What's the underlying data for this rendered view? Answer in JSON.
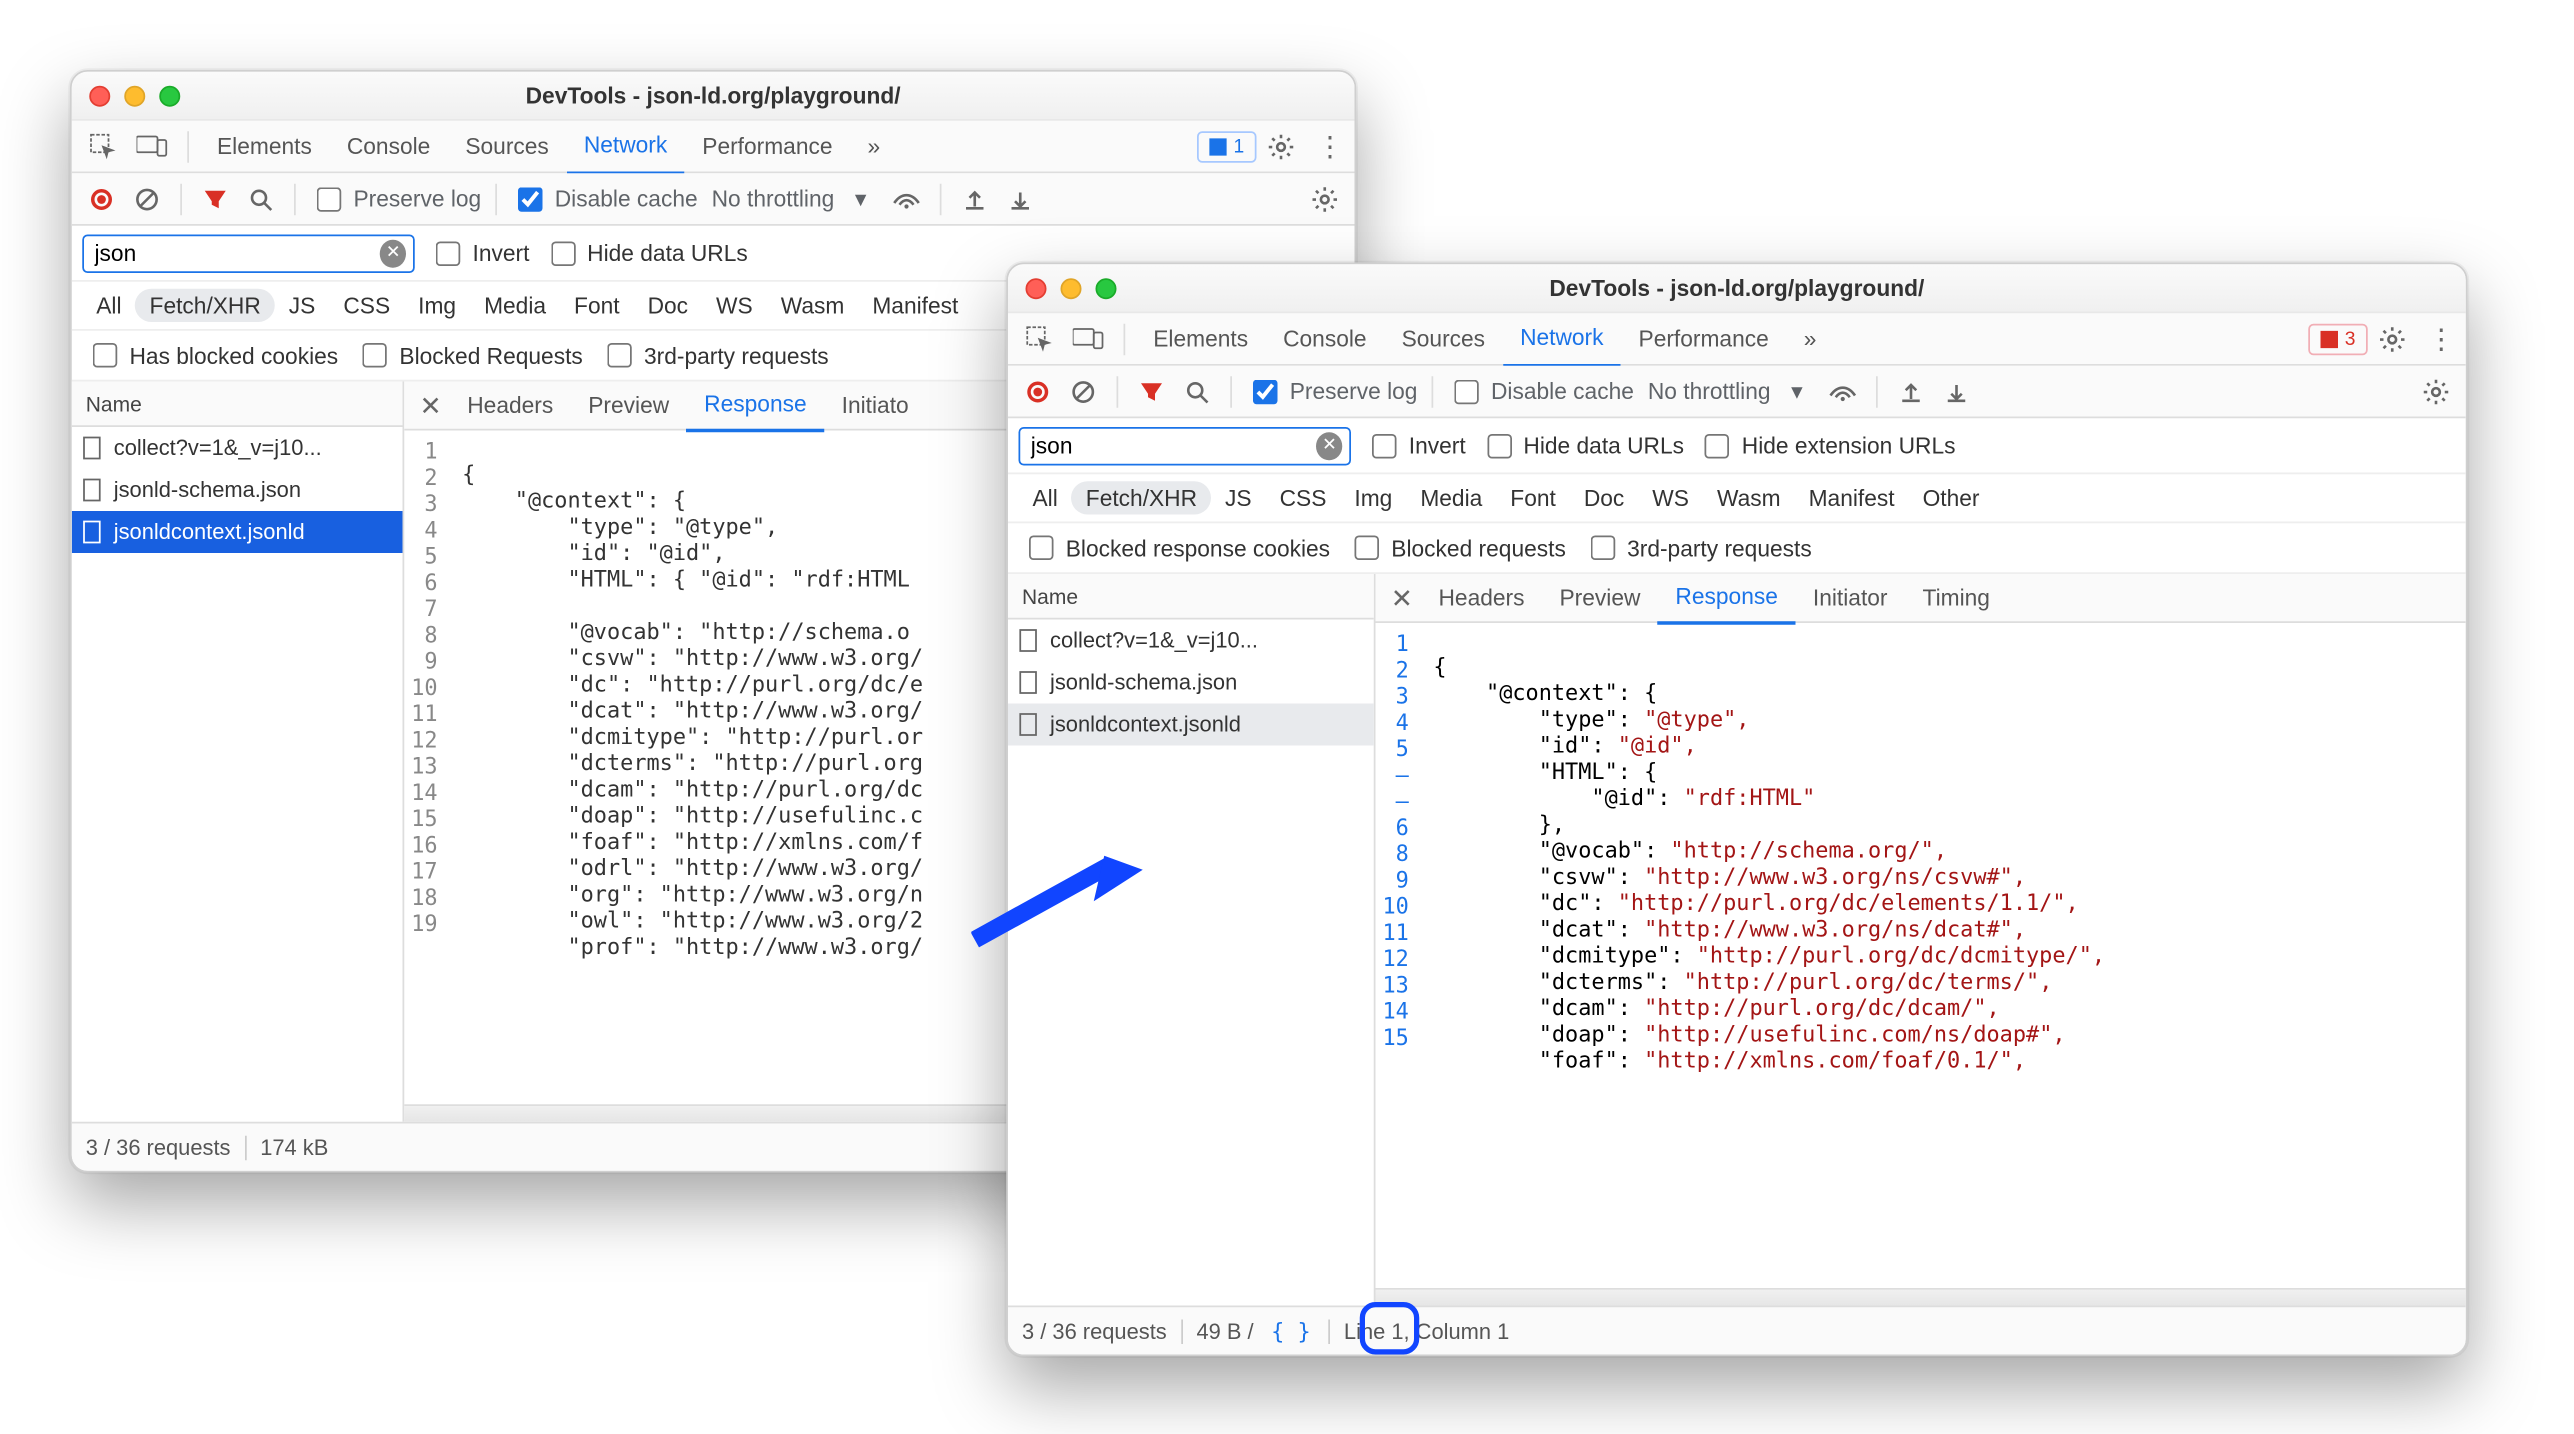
{
  "meta": {
    "source_page": "DevTools - json-ld.org/playground/"
  },
  "windowA": {
    "title": "DevTools - json-ld.org/playground/",
    "tabs": [
      "Elements",
      "Console",
      "Sources",
      "Network",
      "Performance"
    ],
    "active_tab": "Network",
    "issue_badge": "1",
    "toolbar": {
      "preserve_log": false,
      "preserve_log_label": "Preserve log",
      "disable_cache": true,
      "disable_cache_label": "Disable cache",
      "throttling": "No throttling"
    },
    "filter": {
      "value": "json",
      "invert_label": "Invert",
      "hide_data_label": "Hide data URLs"
    },
    "types": [
      "All",
      "Fetch/XHR",
      "JS",
      "CSS",
      "Img",
      "Media",
      "Font",
      "Doc",
      "WS",
      "Wasm",
      "Manifest"
    ],
    "type_active": "Fetch/XHR",
    "extra_checks": [
      "Has blocked cookies",
      "Blocked Requests",
      "3rd-party requests"
    ],
    "list_header": "Name",
    "requests": [
      "collect?v=1&_v=j10...",
      "jsonld-schema.json",
      "jsonldcontext.jsonld"
    ],
    "selected_request_index": 2,
    "detail_tabs": [
      "Headers",
      "Preview",
      "Response",
      "Initiato"
    ],
    "detail_active": "Response",
    "gutter": [
      "1",
      "2",
      "3",
      "4",
      "5",
      "6",
      "7",
      "8",
      "9",
      "10",
      "11",
      "12",
      "13",
      "14",
      "15",
      "16",
      "17",
      "18",
      "19"
    ],
    "code_lines": [
      "{",
      "    \"@context\": {",
      "        \"type\": \"@type\",",
      "        \"id\": \"@id\",",
      "        \"HTML\": { \"@id\": \"rdf:HTML",
      "",
      "        \"@vocab\": \"http://schema.o",
      "        \"csvw\": \"http://www.w3.org/",
      "        \"dc\": \"http://purl.org/dc/e",
      "        \"dcat\": \"http://www.w3.org/",
      "        \"dcmitype\": \"http://purl.or",
      "        \"dcterms\": \"http://purl.org",
      "        \"dcam\": \"http://purl.org/dc",
      "        \"doap\": \"http://usefulinc.c",
      "        \"foaf\": \"http://xmlns.com/f",
      "        \"odrl\": \"http://www.w3.org/",
      "        \"org\": \"http://www.w3.org/n",
      "        \"owl\": \"http://www.w3.org/2",
      "        \"prof\": \"http://www.w3.org/"
    ],
    "status": {
      "requests": "3 / 36 requests",
      "size": "174 kB"
    }
  },
  "windowB": {
    "title": "DevTools - json-ld.org/playground/",
    "tabs": [
      "Elements",
      "Console",
      "Sources",
      "Network",
      "Performance"
    ],
    "active_tab": "Network",
    "error_badge": "3",
    "toolbar": {
      "preserve_log": true,
      "preserve_log_label": "Preserve log",
      "disable_cache": false,
      "disable_cache_label": "Disable cache",
      "throttling": "No throttling"
    },
    "filter": {
      "value": "json",
      "invert_label": "Invert",
      "hide_data_label": "Hide data URLs",
      "hide_ext_label": "Hide extension URLs"
    },
    "types": [
      "All",
      "Fetch/XHR",
      "JS",
      "CSS",
      "Img",
      "Media",
      "Font",
      "Doc",
      "WS",
      "Wasm",
      "Manifest",
      "Other"
    ],
    "type_active": "Fetch/XHR",
    "extra_checks": [
      "Blocked response cookies",
      "Blocked requests",
      "3rd-party requests"
    ],
    "list_header": "Name",
    "requests": [
      "collect?v=1&_v=j10...",
      "jsonld-schema.json",
      "jsonldcontext.jsonld"
    ],
    "selected_request_index": 2,
    "detail_tabs": [
      "Headers",
      "Preview",
      "Response",
      "Initiator",
      "Timing"
    ],
    "detail_active": "Response",
    "gutter": [
      "1",
      "2",
      "3",
      "4",
      "5",
      "–",
      "–",
      "6",
      "8",
      "9",
      "10",
      "11",
      "12",
      "13",
      "14",
      "15"
    ],
    "code_plain": [
      "{",
      "    \"@context\": {",
      "        \"type\": ",
      "        \"id\": ",
      "        \"HTML\": {",
      "            \"@id\": ",
      "        },",
      "        \"@vocab\": ",
      "        \"csvw\": ",
      "        \"dc\": ",
      "        \"dcat\": ",
      "        \"dcmitype\": ",
      "        \"dcterms\": ",
      "        \"dcam\": ",
      "        \"doap\": ",
      "        \"foaf\": "
    ],
    "code_values": [
      "",
      "",
      "\"@type\",",
      "\"@id\",",
      "",
      "\"rdf:HTML\"",
      "",
      "\"http://schema.org/\",",
      "\"http://www.w3.org/ns/csvw#\",",
      "\"http://purl.org/dc/elements/1.1/\",",
      "\"http://www.w3.org/ns/dcat#\",",
      "\"http://purl.org/dc/dcmitype/\",",
      "\"http://purl.org/dc/terms/\",",
      "\"http://purl.org/dc/dcam/\",",
      "\"http://usefulinc.com/ns/doap#\",",
      "\"http://xmlns.com/foaf/0.1/\","
    ],
    "status": {
      "requests": "3 / 36 requests",
      "size": "49 B /",
      "cursor": "Line 1, Column 1"
    }
  }
}
